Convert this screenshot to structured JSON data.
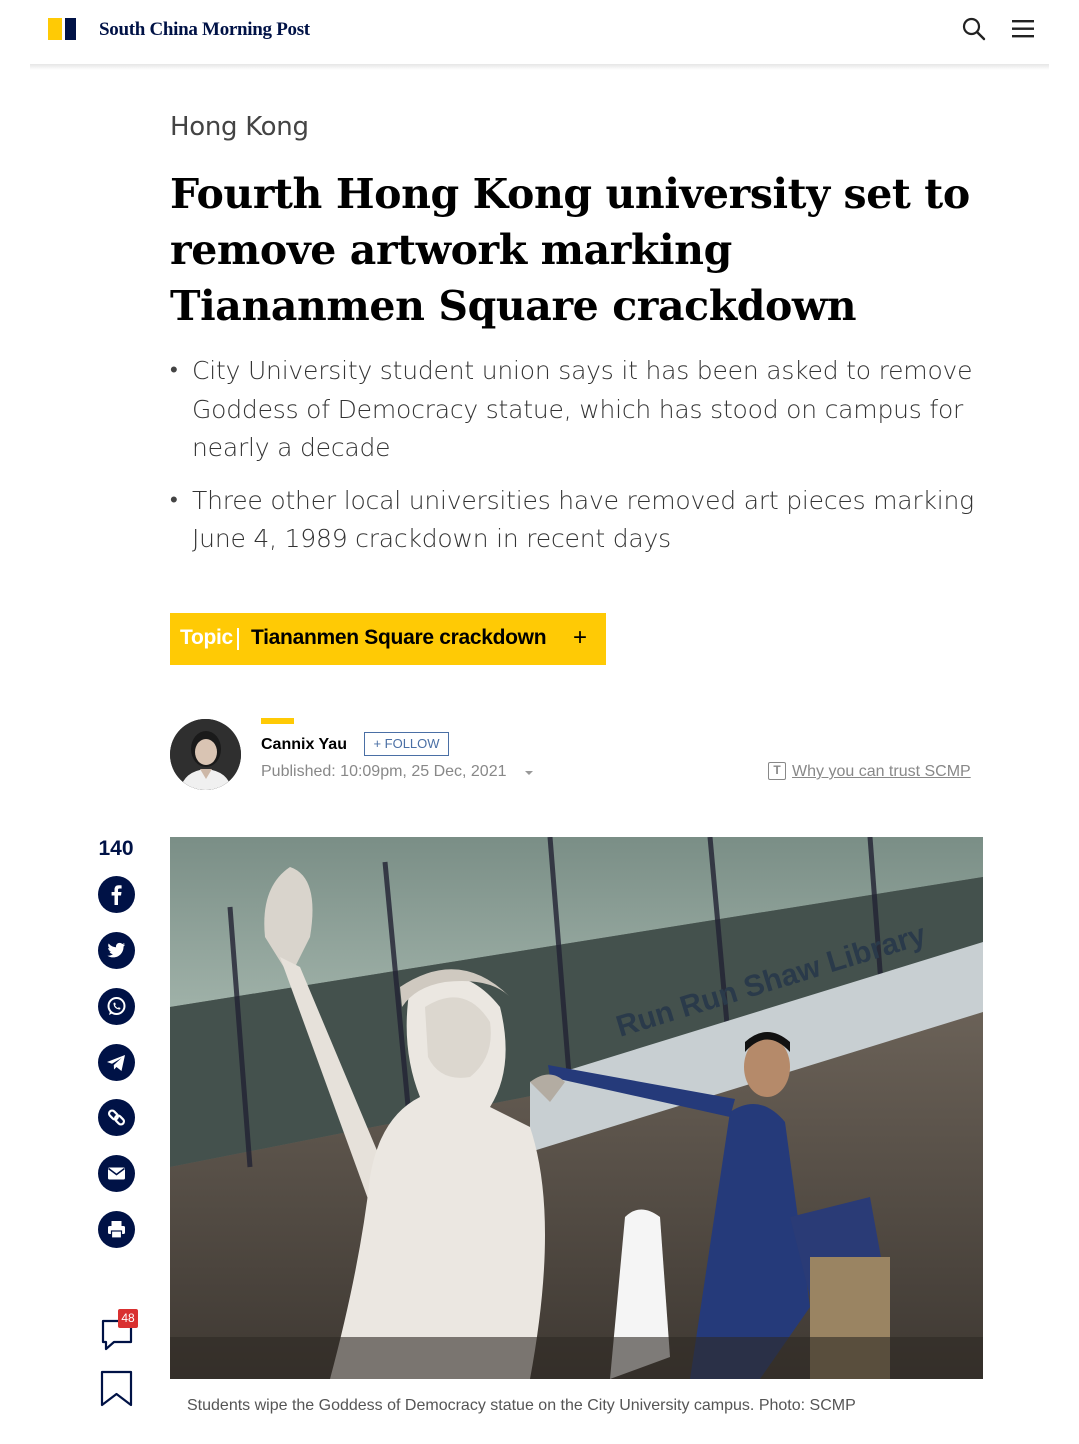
{
  "header": {
    "brand": "South China Morning Post",
    "search_icon": "search-icon",
    "menu_icon": "hamburger-menu-icon"
  },
  "article": {
    "section": "Hong Kong",
    "headline": "Fourth Hong Kong university set to remove artwork marking Tiananmen Square crackdown",
    "summary": [
      "City University student union says it has been asked to remove Goddess of Democracy statue, which has stood on campus for nearly a decade",
      "Three other local universities have removed art pieces marking June 4, 1989 crackdown in recent days"
    ],
    "topic": {
      "label": "Topic",
      "name": "Tiananmen Square crackdown",
      "action": "+"
    },
    "author": {
      "name": "Cannix Yau",
      "follow_label": "+ FOLLOW",
      "published": "Published: 10:09pm, 25 Dec, 2021"
    },
    "trust_link": "Why you can trust SCMP",
    "image": {
      "sign_text": "Run Run Shaw Library",
      "caption": "Students wipe the Goddess of Democracy statue on the City University campus. Photo: SCMP"
    }
  },
  "share": {
    "count": "140",
    "buttons": [
      "facebook-icon",
      "twitter-icon",
      "whatsapp-icon",
      "telegram-icon",
      "link-icon",
      "email-icon",
      "print-icon"
    ],
    "comment_count": "48"
  },
  "colors": {
    "brand_navy": "#001246",
    "brand_yellow": "#FFCA05",
    "badge_red": "#d93030"
  }
}
